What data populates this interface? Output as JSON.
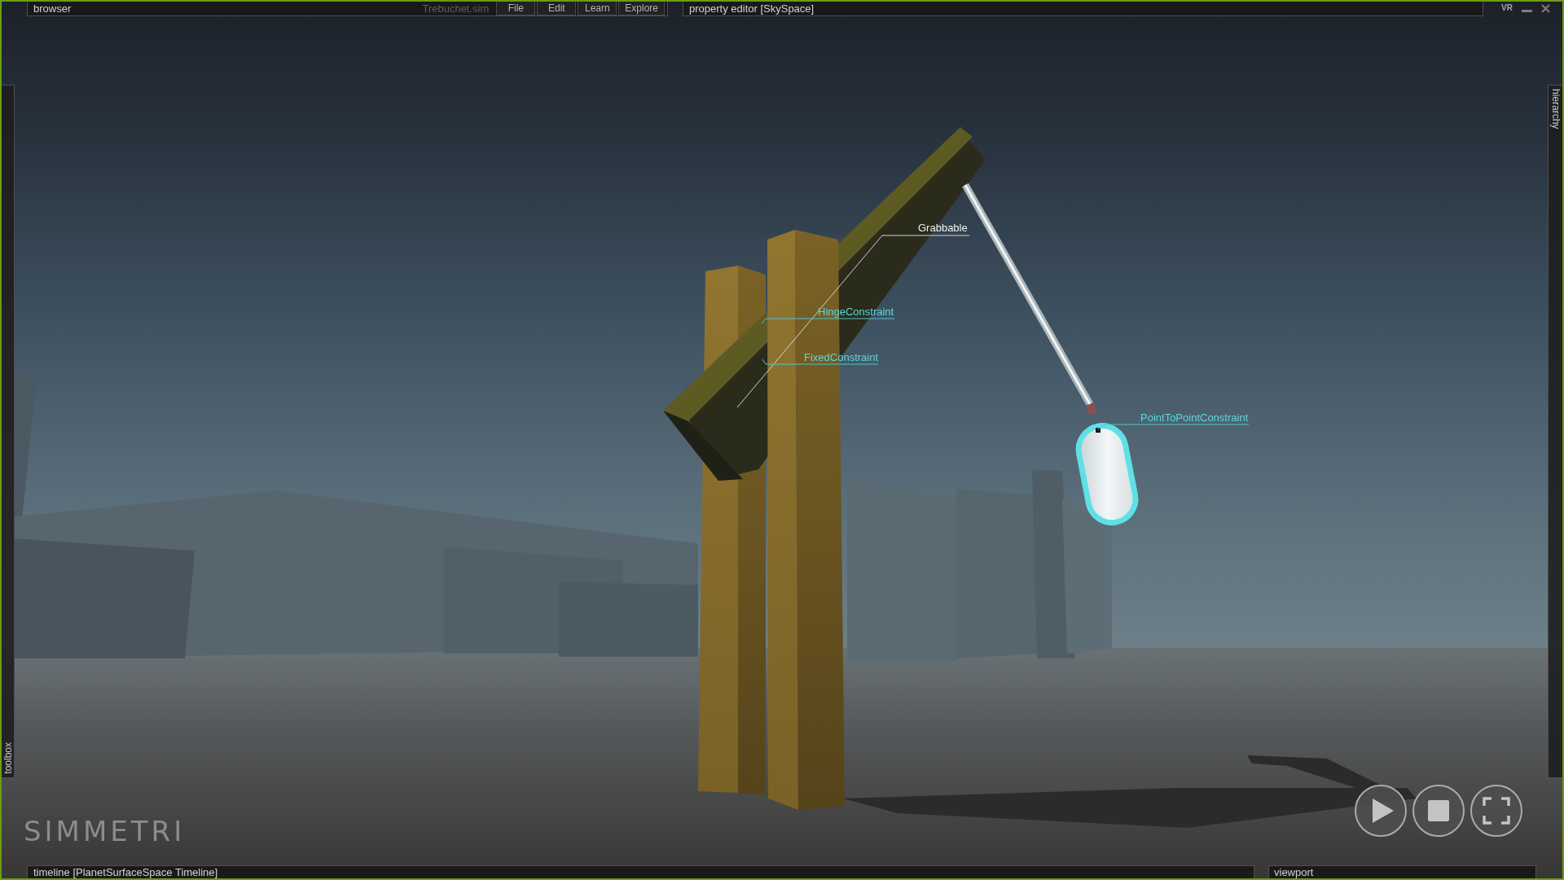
{
  "browser": {
    "title": "browser",
    "file_name": "Trebuchet.sim",
    "menu": [
      "File",
      "Edit",
      "Learn",
      "Explore"
    ]
  },
  "property_editor": {
    "title": "property editor [SkySpace]"
  },
  "window_controls": [
    {
      "kind": "vr",
      "label": "VR"
    },
    {
      "kind": "minimize"
    },
    {
      "kind": "close"
    }
  ],
  "toolbox": {
    "title": "toolbox"
  },
  "hierarchy": {
    "title": "hierarchy"
  },
  "scene": {
    "annotations": [
      {
        "kind": "grabbable",
        "label": "Grabbable"
      },
      {
        "kind": "constraint",
        "label": "HingeConstraint"
      },
      {
        "kind": "constraint",
        "label": "FixedConstraint"
      },
      {
        "kind": "constraint",
        "label": "PointToPointConstraint"
      }
    ],
    "logo": "SIMMETRI",
    "playback_controls": [
      {
        "kind": "play"
      },
      {
        "kind": "stop"
      },
      {
        "kind": "fullscreen"
      }
    ]
  },
  "timeline": {
    "title": "timeline [PlanetSurfaceSpace Timeline]"
  },
  "viewport": {
    "title": "viewport"
  }
}
